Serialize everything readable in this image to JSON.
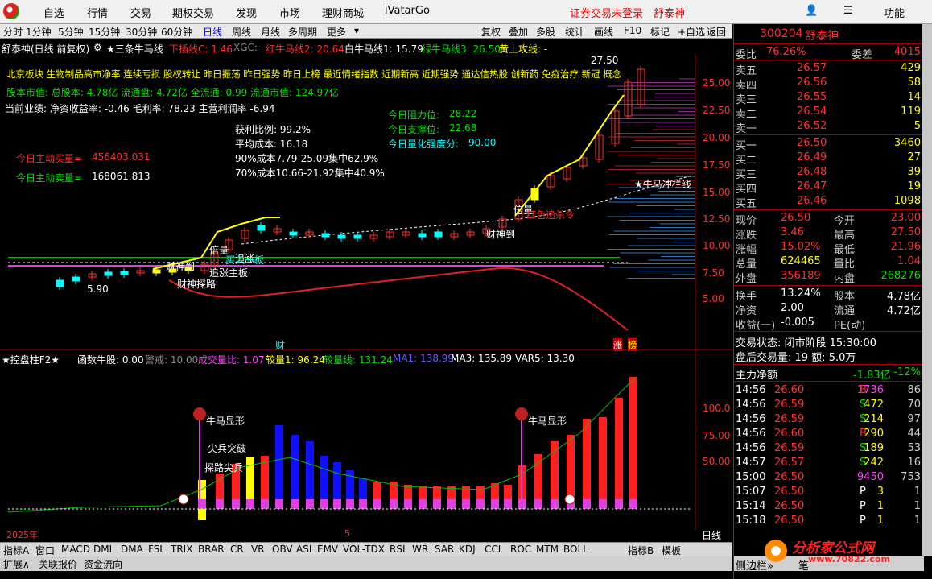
{
  "menu": {
    "items": [
      "自选",
      "行情",
      "交易",
      "期权交易",
      "发现",
      "市场",
      "理财商城",
      "iVatarGo"
    ],
    "warning": "证券交易未登录",
    "stock_name": "舒泰神",
    "function_label": "功能"
  },
  "toolbar": {
    "periods": [
      "分时",
      "1分钟",
      "5分钟",
      "15分钟",
      "30分钟",
      "60分钟",
      "日线",
      "周线",
      "月线",
      "多周期",
      "更多"
    ],
    "tools": [
      "复权",
      "叠加",
      "多股",
      "统计",
      "画线",
      "F10",
      "标记",
      "+自选",
      "返回"
    ]
  },
  "main_chart": {
    "title": "舒泰神(日线 前复权)",
    "indicator_name": "★三条牛马线",
    "lines": [
      {
        "label": "下插线C: 1.46",
        "color": "#ff3030"
      },
      {
        "label": "XGC: -",
        "color": "#888888"
      },
      {
        "label": "红牛马线2: 20.64",
        "color": "#ff3030"
      },
      {
        "label": "白牛马线1: 15.79",
        "color": "#ffffff"
      },
      {
        "label": "绿牛马线3: 26.50",
        "color": "#00e000"
      },
      {
        "label": "黄上攻线: -",
        "color": "#ffff00"
      }
    ],
    "info_line1": "北京板块  生物制品高市净率 连续亏损 股权转让 昨日振荡 昨日强势 昨日上榜 最近情绪指数 近期新高 近期强势 通达信热股  创新药 免疫治疗 新冠 概念",
    "info_line2": "股本市值: 总股本: 4.78亿 流通盘: 4.72亿 全流通: 0.99 流通市值: 124.97亿",
    "info_line3": "当前业绩: 净资收益率: -0.46 毛利率: 78.23 主营利润率 -6.94",
    "buy_label": "今日主动买量=",
    "buy_value": "456403.031",
    "sell_label": "今日主动卖量=",
    "sell_value": "168061.813",
    "chip": {
      "profit_ratio": "获利比例: 99.2%",
      "avg_cost": "平均成本: 16.18",
      "cost90": "90%成本7.79-25.09集中62.9%",
      "cost70": "70%成本10.66-21.92集中40.9%"
    },
    "resistance": {
      "label": "今日阻力位:",
      "value": "28.22"
    },
    "support": {
      "label": "今日支撑位:",
      "value": "22.68"
    },
    "strength": {
      "label": "今日量化强度分:",
      "value": "90.00"
    },
    "y_ticks": [
      "25.00",
      "22.50",
      "20.00",
      "17.50",
      "15.00",
      "12.50",
      "10.00",
      "7.50",
      "5.00"
    ],
    "high_label": "27.50",
    "low_label": "5.90",
    "annotations": [
      "★牛马冲栏线",
      "倍量",
      "红色追杀令",
      "财神到",
      "倍量",
      "财神到",
      "追涨",
      "财神探路",
      "追涨主板",
      "买入一板",
      "财",
      "涨",
      "榜"
    ]
  },
  "sub_chart": {
    "indicator_name": "★控盘柱F2★",
    "values": [
      {
        "label": "函数牛股: 0.00",
        "color": "#ffffff"
      },
      {
        "label": "警戒: 10.00",
        "color": "#888888"
      },
      {
        "label": "成交量比: 1.07",
        "color": "#ff40ff"
      },
      {
        "label": "较量1: 96.24",
        "color": "#ffff00"
      },
      {
        "label": "较量线: 131.24",
        "color": "#00e000"
      },
      {
        "label": "MA1: 138.99",
        "color": "#6060ff"
      },
      {
        "label": "MA3: 135.89",
        "color": "#ffffff"
      },
      {
        "label": "VAR5: 13.30",
        "color": "#ffffff"
      }
    ],
    "y_ticks": [
      "100.0",
      "75.00",
      "50.00"
    ],
    "annotations": [
      "牛马显形",
      "尖兵突破",
      "探路尖兵",
      "牛马显形"
    ],
    "year_label": "2025年",
    "month_label": "5",
    "period_label": "日线"
  },
  "bottom_tabs": [
    "指标A",
    "窗口",
    "MACD",
    "DMI",
    "DMA",
    "FSL",
    "TRIX",
    "BRAR",
    "CR",
    "VR",
    "OBV",
    "ASI",
    "EMV",
    "VOL-TDX",
    "RSI",
    "WR",
    "SAR",
    "KDJ",
    "CCI",
    "ROC",
    "MTM",
    "BOLL",
    "指标B",
    "模板"
  ],
  "status_tabs": [
    "扩展∧",
    "关联报价",
    "资金流向"
  ],
  "panel": {
    "code": "300204",
    "name": "舒泰神",
    "weibi_label": "委比",
    "weibi_value": "76.26%",
    "weicha_label": "委差",
    "weicha_value": "4015",
    "asks": [
      {
        "label": "卖五",
        "price": "26.57",
        "vol": "429"
      },
      {
        "label": "卖四",
        "price": "26.56",
        "vol": "58"
      },
      {
        "label": "卖三",
        "price": "26.55",
        "vol": "14"
      },
      {
        "label": "卖二",
        "price": "26.54",
        "vol": "119"
      },
      {
        "label": "卖一",
        "price": "26.52",
        "vol": "5"
      }
    ],
    "bids": [
      {
        "label": "买一",
        "price": "26.50",
        "vol": "3460"
      },
      {
        "label": "买二",
        "price": "26.49",
        "vol": "27"
      },
      {
        "label": "买三",
        "price": "26.48",
        "vol": "39"
      },
      {
        "label": "买四",
        "price": "26.47",
        "vol": "19"
      },
      {
        "label": "买五",
        "price": "26.46",
        "vol": "1098"
      }
    ],
    "quote": [
      {
        "l1": "现价",
        "v1": "26.50",
        "l2": "今开",
        "v2": "23.00",
        "c1": "#ff3030",
        "c2": "#ff3030"
      },
      {
        "l1": "涨跌",
        "v1": "3.46",
        "l2": "最高",
        "v2": "27.50",
        "c1": "#ff3030",
        "c2": "#ff3030"
      },
      {
        "l1": "涨幅",
        "v1": "15.02%",
        "l2": "最低",
        "v2": "21.96",
        "c1": "#ff3030",
        "c2": "#ff3030"
      },
      {
        "l1": "总量",
        "v1": "624465",
        "l2": "量比",
        "v2": "1.04",
        "c1": "#ffff00",
        "c2": "#ff3030"
      },
      {
        "l1": "外盘",
        "v1": "356189",
        "l2": "内盘",
        "v2": "268276",
        "c1": "#ff3030",
        "c2": "#00e000"
      }
    ],
    "fund": [
      {
        "l1": "换手",
        "v1": "13.24%",
        "l2": "股本",
        "v2": "4.78亿"
      },
      {
        "l1": "净资",
        "v1": "2.00",
        "l2": "流通",
        "v2": "4.72亿"
      },
      {
        "l1": "收益(一)",
        "v1": "-0.005",
        "l2": "PE(动)",
        "v2": ""
      }
    ],
    "trade_status": "交易状态: 闭市阶段 15:30:00",
    "after_hours": "盘后交易量: 19  额: 5.0万",
    "netflow_label": "主力净额",
    "netflow_value": "-1.83亿",
    "netflow_pct": "-12%",
    "ticks": [
      {
        "time": "14:56",
        "price": "26.60",
        "vol": "1736",
        "bs": "B",
        "n": "86",
        "vc": "#ff40ff"
      },
      {
        "time": "14:56",
        "price": "26.59",
        "vol": "472",
        "bs": "S",
        "n": "70",
        "vc": "#ffff00"
      },
      {
        "time": "14:56",
        "price": "26.59",
        "vol": "214",
        "bs": "S",
        "n": "97",
        "vc": "#ffff00"
      },
      {
        "time": "14:56",
        "price": "26.60",
        "vol": "290",
        "bs": "B",
        "n": "44",
        "vc": "#ffff00"
      },
      {
        "time": "14:56",
        "price": "26.59",
        "vol": "189",
        "bs": "S",
        "n": "53",
        "vc": "#ffff00"
      },
      {
        "time": "14:57",
        "price": "26.57",
        "vol": "242",
        "bs": "S",
        "n": "16",
        "vc": "#ffff00"
      },
      {
        "time": "15:00",
        "price": "26.50",
        "vol": "9450",
        "bs": "",
        "n": "753",
        "vc": "#ff40ff"
      },
      {
        "time": "15:07",
        "price": "26.50",
        "vol": "3",
        "bs": "P",
        "n": "1",
        "vc": "#ffff00"
      },
      {
        "time": "15:14",
        "price": "26.50",
        "vol": "1",
        "bs": "P",
        "n": "1",
        "vc": "#ffff00"
      },
      {
        "time": "15:18",
        "price": "26.50",
        "vol": "1",
        "bs": "P",
        "n": "1",
        "vc": "#ffff00"
      }
    ],
    "side_tab": "侧边栏»",
    "bi_label": "笔"
  },
  "watermark": {
    "brand": "分析家公式网",
    "url": "www.70822.com"
  },
  "colors": {
    "up": "#ff3030",
    "down": "#00e000",
    "blue_bar": "#1010ff",
    "bg": "#000000"
  }
}
